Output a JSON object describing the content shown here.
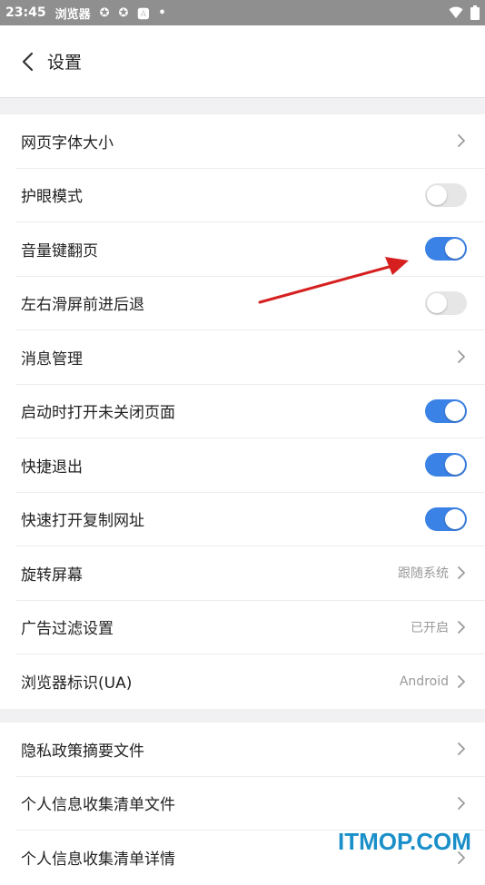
{
  "status_bar": {
    "time": "23:45",
    "app_name": "浏览器",
    "icons": [
      "sync-icon",
      "sync-icon",
      "a-icon",
      "dot-icon"
    ],
    "right_icons": [
      "wifi-icon",
      "battery-icon"
    ]
  },
  "header": {
    "title": "设置"
  },
  "group1": [
    {
      "label": "网页字体大小",
      "type": "link",
      "value": ""
    },
    {
      "label": "护眼模式",
      "type": "toggle",
      "on": false
    },
    {
      "label": "音量键翻页",
      "type": "toggle",
      "on": true
    },
    {
      "label": "左右滑屏前进后退",
      "type": "toggle",
      "on": false
    },
    {
      "label": "消息管理",
      "type": "link",
      "value": ""
    },
    {
      "label": "启动时打开未关闭页面",
      "type": "toggle",
      "on": true
    },
    {
      "label": "快捷退出",
      "type": "toggle",
      "on": true
    },
    {
      "label": "快速打开复制网址",
      "type": "toggle",
      "on": true
    },
    {
      "label": "旋转屏幕",
      "type": "link",
      "value": "跟随系统"
    },
    {
      "label": "广告过滤设置",
      "type": "link",
      "value": "已开启"
    },
    {
      "label": "浏览器标识(UA)",
      "type": "link",
      "value": "Android"
    }
  ],
  "group2": [
    {
      "label": "隐私政策摘要文件",
      "type": "link",
      "value": ""
    },
    {
      "label": "个人信息收集清单文件",
      "type": "link",
      "value": ""
    },
    {
      "label": "个人信息收集清单详情",
      "type": "link",
      "value": ""
    }
  ],
  "colors": {
    "toggle_on": "#3b82e6",
    "toggle_off": "#e6e6e6",
    "annotation_arrow": "#d62020",
    "watermark": "#1a8fc9"
  },
  "watermark": "ITMOP.COM"
}
